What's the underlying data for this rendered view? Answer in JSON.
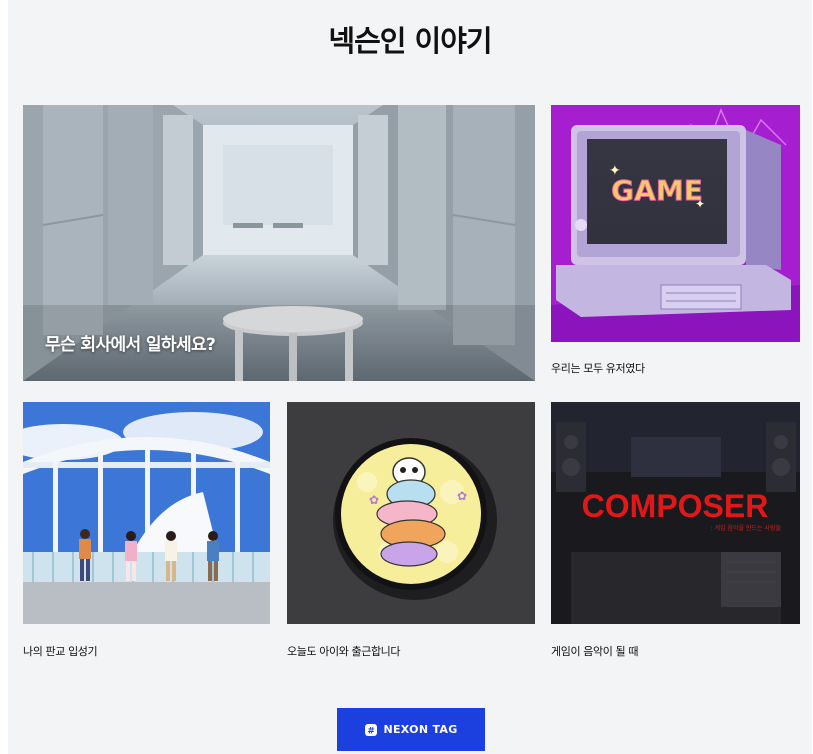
{
  "page": {
    "title": "넥슨인 이야기"
  },
  "cards": [
    {
      "caption": "무슨 회사에서 일하세요?"
    },
    {
      "caption": "우리는 모두 유저였다",
      "image_text": "GAME"
    },
    {
      "caption": "나의 판교 입성기"
    },
    {
      "caption": "오늘도 아이와 출근합니다"
    },
    {
      "caption": "게임이 음악이 될 때",
      "image_text": "COMPOSER",
      "image_subtext": ": 게임 음악을 만드는 사람들"
    }
  ],
  "footer": {
    "button_label": "NEXON TAG",
    "button_icon": "nexon-tag-icon"
  },
  "colors": {
    "background": "#f2f4f6",
    "button": "#1c3fe0",
    "composer_red": "#e01818",
    "game_purple": "#a020d0"
  }
}
